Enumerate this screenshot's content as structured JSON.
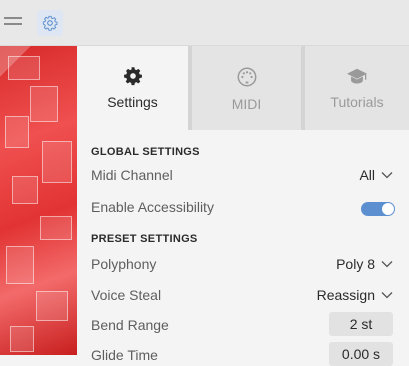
{
  "topbar": {
    "menu_icon": "hamburger-icon",
    "settings_icon": "gear-icon",
    "accent": "#5b8fcf"
  },
  "tabs": [
    {
      "label": "Settings",
      "icon": "gear-icon",
      "active": true
    },
    {
      "label": "MIDI",
      "icon": "midi-port-icon",
      "active": false
    },
    {
      "label": "Tutorials",
      "icon": "graduation-cap-icon",
      "active": false
    }
  ],
  "global": {
    "heading": "GLOBAL SETTINGS",
    "midi_channel_label": "Midi Channel",
    "midi_channel_value": "All",
    "accessibility_label": "Enable Accessibility",
    "accessibility_on": true
  },
  "preset": {
    "heading": "PRESET SETTINGS",
    "polyphony_label": "Polyphony",
    "polyphony_value": "Poly 8",
    "voice_steal_label": "Voice Steal",
    "voice_steal_value": "Reassign",
    "bend_range_label": "Bend Range",
    "bend_range_value": "2 st",
    "glide_time_label": "Glide Time",
    "glide_time_value": "0.00 s"
  }
}
